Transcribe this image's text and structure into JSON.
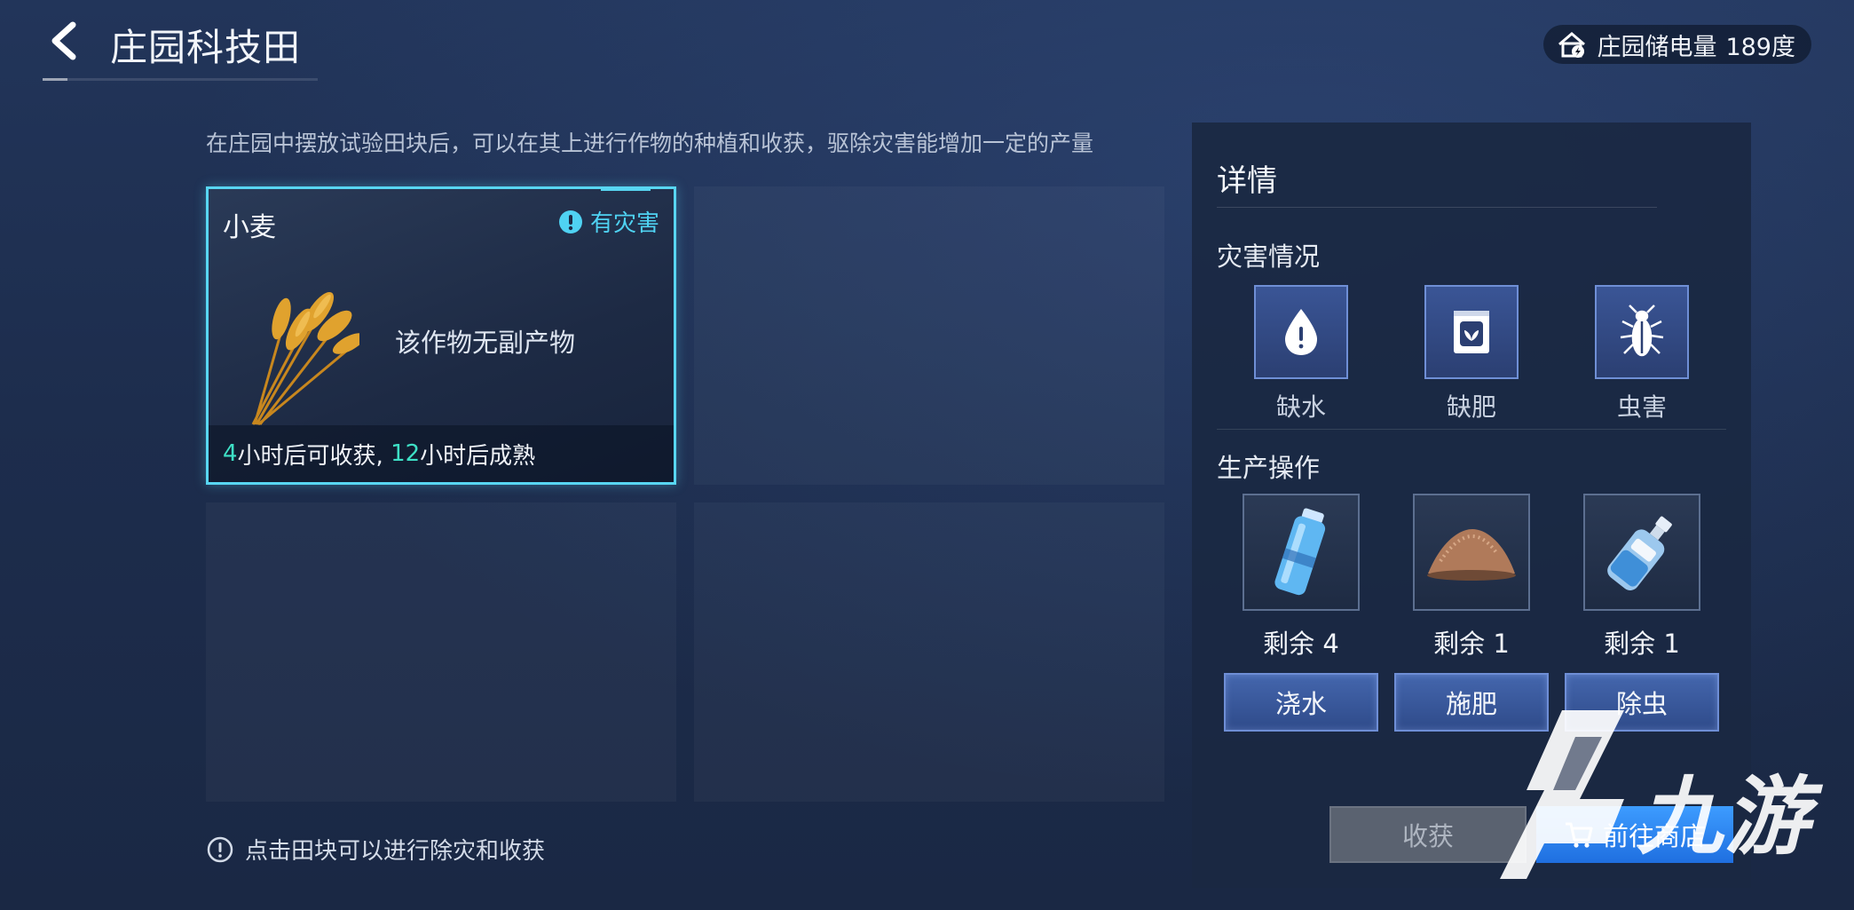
{
  "header": {
    "title": "庄园科技田",
    "power": {
      "label": "庄园储电量",
      "value": "189度"
    }
  },
  "description": "在庄园中摆放试验田块后，可以在其上进行作物的种植和收获，驱除灾害能增加一定的产量",
  "crop_card": {
    "name": "小麦",
    "disaster_flag": "有灾害",
    "byproduct": "该作物无副产物",
    "harvest_hours": "4",
    "harvest_text": "小时后可收获,",
    "mature_hours": "12",
    "mature_text": "小时后成熟"
  },
  "hint": "点击田块可以进行除灾和收获",
  "detail": {
    "title": "详情",
    "disaster_section": "灾害情况",
    "disasters": [
      {
        "label": "缺水",
        "icon": "water-drop-warning-icon"
      },
      {
        "label": "缺肥",
        "icon": "fertilizer-bag-icon"
      },
      {
        "label": "虫害",
        "icon": "bug-icon"
      }
    ],
    "operation_section": "生产操作",
    "operations": [
      {
        "remaining": "剩余 4",
        "button": "浇水",
        "icon": "water-bottle-icon"
      },
      {
        "remaining": "剩余 1",
        "button": "施肥",
        "icon": "fertilizer-pile-icon"
      },
      {
        "remaining": "剩余 1",
        "button": "除虫",
        "icon": "pesticide-bottle-icon"
      }
    ],
    "harvest_button": "收获",
    "shop_button": "前往商店"
  },
  "watermark": {
    "text": "九游"
  },
  "colors": {
    "accent": "#58d6f2",
    "teal": "#3ee0c6",
    "shop": "#2f86f2"
  }
}
